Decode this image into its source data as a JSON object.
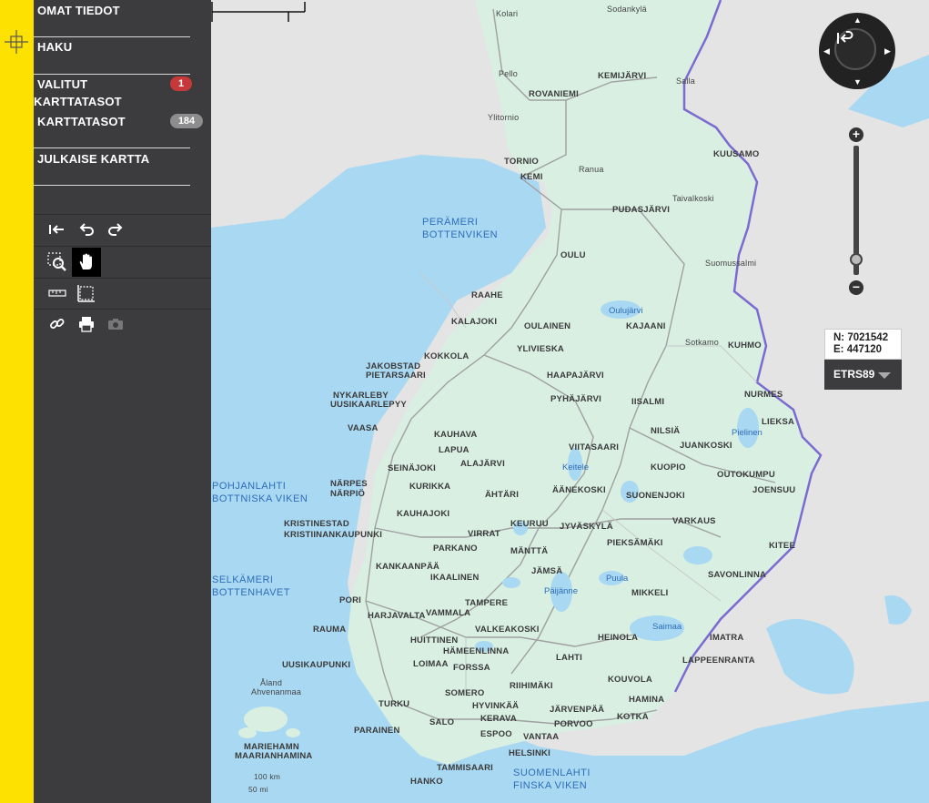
{
  "sidebar": {
    "menu": [
      {
        "label": "OMAT TIEDOT"
      },
      {
        "label": "HAKU"
      },
      {
        "label": "VALITUT KARTTATASOT",
        "badge": "1"
      },
      {
        "label": "KARTTATASOT",
        "badge": "184"
      },
      {
        "label": "JULKAISE KARTTA"
      }
    ],
    "tools": [
      "back-icon",
      "undo-icon",
      "redo-icon",
      "zoom-box-icon",
      "pan-hand-icon",
      "measure-line-icon",
      "measure-area-icon",
      "link-icon",
      "print-icon",
      "camera-icon"
    ]
  },
  "map": {
    "coordinates": {
      "n_label": "N: 7021542",
      "e_label": "E: 447120"
    },
    "crs": "ETRS89",
    "scale": {
      "km": "100 km",
      "mi": "50 mi"
    },
    "seas": [
      {
        "l1": "PERÄMERI",
        "l2": "BOTTENVIKEN"
      },
      {
        "l1": "POHJANLAHTI",
        "l2": "BOTTNISKA VIKEN"
      },
      {
        "l1": "SELKÄMERI",
        "l2": "BOTTENHAVET"
      },
      {
        "l1": "SUOMENLAHTI",
        "l2": "FINSKA VIKEN"
      }
    ],
    "lakes": [
      "Oulujärvi",
      "Pielinen",
      "Keitele",
      "Päijänne",
      "Puula",
      "Saimaa"
    ],
    "places": [
      "Kolari",
      "Sodankylä",
      "Pello",
      "KEMIJÄRVI",
      "Salla",
      "ROVANIEMI",
      "Ylitornio",
      "KUUSAMO",
      "TORNIO",
      "Ranua",
      "KEMI",
      "Taivalkoski",
      "PUDASJÄRVI",
      "OULU",
      "Suomussalmi",
      "RAAHE",
      "KALAJOKI",
      "OULAINEN",
      "KAJAANI",
      "KOKKOLA",
      "YLIVIESKA",
      "Sotkamo",
      "KUHMO",
      "JAKOBSTAD",
      "PIETARSAARI",
      "HAAPAJÄRVI",
      "NYKARLEBY",
      "UUSIKAARLEPYY",
      "PYHÄJÄRVI",
      "IISALMI",
      "NURMES",
      "LIEKSA",
      "VAASA",
      "KAUHAVA",
      "NILSIÄ",
      "LAPUA",
      "JUANKOSKI",
      "ALAJÄRVI",
      "VIITASAARI",
      "SEINÄJOKI",
      "KUOPIO",
      "OUTOKUMPU",
      "NÄRPES",
      "NÄRPIÖ",
      "KURIKKA",
      "ÄHTÄRI",
      "ÄÄNEKOSKI",
      "SUONENJOKI",
      "JOENSUU",
      "KAUHAJOKI",
      "KRISTINESTAD",
      "KRISTIINANKAUPUNKI",
      "VIRRAT",
      "KEURUU",
      "JYVÄSKYLÄ",
      "VARKAUS",
      "PARKANO",
      "MÄNTTÄ",
      "PIEKSÄMÄKI",
      "KITEE",
      "KANKAANPÄÄ",
      "JÄMSÄ",
      "IKAALINEN",
      "SAVONLINNA",
      "PORI",
      "MIKKELI",
      "TAMPERE",
      "HARJAVALTA",
      "VAMMALA",
      "RAUMA",
      "VALKEAKOSKI",
      "HEINOLA",
      "IMATRA",
      "HUITTINEN",
      "HÄMEENLINNA",
      "LAHTI",
      "LAPPEENRANTA",
      "UUSIKAUPUNKI",
      "LOIMAA",
      "FORSSA",
      "RIIHIMÄKI",
      "KOUVOLA",
      "Åland",
      "Ahvenanmaa",
      "SOMERO",
      "HAMINA",
      "TURKU",
      "HYVINKÄÄ",
      "JÄRVENPÄÄ",
      "SALO",
      "KERAVA",
      "PORVOO",
      "KOTKA",
      "PARAINEN",
      "ESPOO",
      "VANTAA",
      "MARIEHAMN",
      "MAARIANHAMINA",
      "HELSINKI",
      "TAMMISAARI",
      "HANKO"
    ]
  },
  "colors": {
    "accent": "#fde100",
    "sidebar": "#3c3c3e",
    "land": "#d8efe2",
    "sea": "#a9d8f2",
    "badge_red": "#c7383b"
  }
}
